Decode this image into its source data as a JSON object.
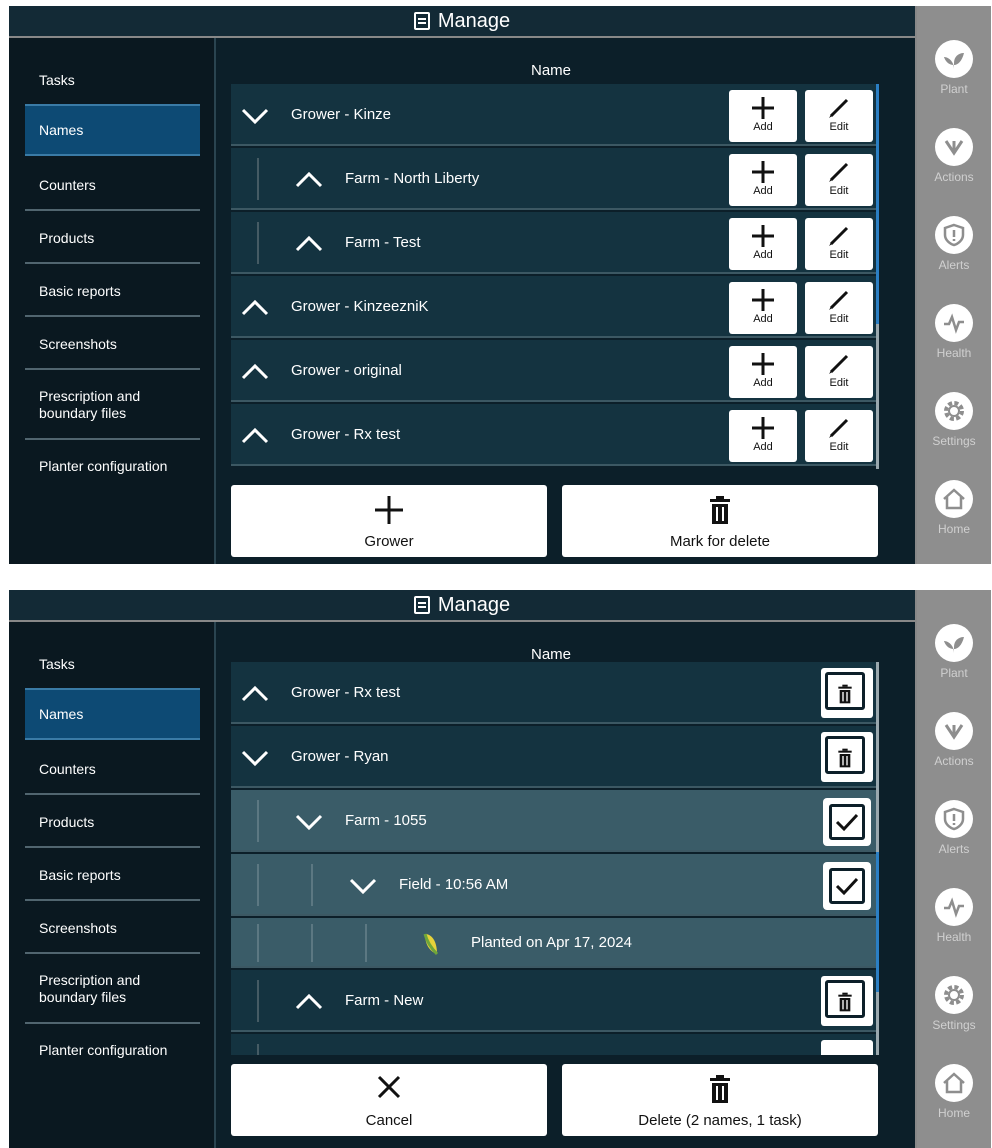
{
  "screen1": {
    "title": "Manage",
    "column_header": "Name",
    "sidebar": [
      "Tasks",
      "Names",
      "Counters",
      "Products",
      "Basic reports",
      "Screenshots",
      "Prescription and\nboundary files",
      "Planter configuration"
    ],
    "active_sidebar": "Names",
    "rows": [
      {
        "label": "Grower - Kinze",
        "expanded": true
      },
      {
        "label": "Farm - North Liberty",
        "expanded": false
      },
      {
        "label": "Farm - Test",
        "expanded": false
      },
      {
        "label": "Grower - KinzeezniK",
        "expanded": false
      },
      {
        "label": "Grower - original",
        "expanded": false
      },
      {
        "label": "Grower - Rx test",
        "expanded": false
      }
    ],
    "add_label": "Add",
    "edit_label": "Edit",
    "bottom_left": "Grower",
    "bottom_right": "Mark for delete"
  },
  "screen2": {
    "title": "Manage",
    "column_header": "Name",
    "sidebar": [
      "Tasks",
      "Names",
      "Counters",
      "Products",
      "Basic reports",
      "Screenshots",
      "Prescription and\nboundary files",
      "Planter configuration"
    ],
    "active_sidebar": "Names",
    "rows": [
      {
        "label": "Grower - Rx test",
        "expanded": false,
        "checked": false
      },
      {
        "label": "Grower - Ryan",
        "expanded": true,
        "checked": false
      },
      {
        "label": "Farm - 1055",
        "expanded": true,
        "checked": true
      },
      {
        "label": "Field - 10:56 AM",
        "expanded": true,
        "checked": true
      },
      {
        "label": "Planted on Apr 17, 2024"
      },
      {
        "label": "Farm - New",
        "expanded": false,
        "checked": false
      }
    ],
    "bottom_left": "Cancel",
    "bottom_right": "Delete (2 names, 1 task)"
  },
  "right_nav": [
    "Plant",
    "Actions",
    "Alerts",
    "Health",
    "Settings",
    "Home"
  ],
  "colors": {
    "header": "#132a36",
    "row": "#143340",
    "selected_row": "#3a5c68",
    "active_nav": "#0d4a74",
    "scroll_thumb": "#2b7fc4",
    "rail": "#8e8e8e"
  }
}
